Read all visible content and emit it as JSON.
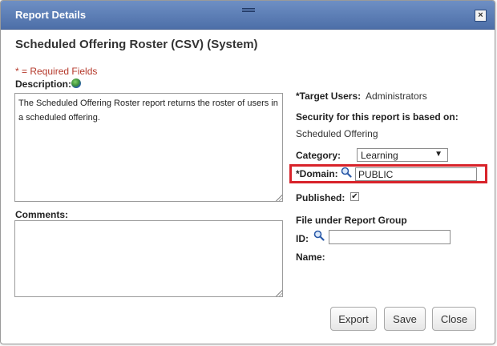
{
  "dialog": {
    "title": "Report Details"
  },
  "report": {
    "heading": "Scheduled Offering Roster (CSV) (System)",
    "required_note": "* = Required Fields",
    "description_label": "Description:",
    "description_text": "The Scheduled Offering Roster report returns the roster of users in a scheduled offering.",
    "comments_label": "Comments:",
    "comments_text": ""
  },
  "details": {
    "target_users_label": "*Target Users:",
    "target_users_value": "Administrators",
    "security_label": "Security for this report is based on:",
    "security_value": "Scheduled Offering",
    "category_label": "Category:",
    "category_value": "Learning",
    "domain_label": "*Domain:",
    "domain_value": "PUBLIC",
    "published_label": "Published:",
    "published_checked": true,
    "report_group_label": "File under Report Group",
    "id_label": "ID:",
    "id_value": "",
    "name_label": "Name:"
  },
  "buttons": {
    "export": "Export",
    "save": "Save",
    "close": "Close"
  },
  "colors": {
    "titlebar": "#5a7cb5",
    "required": "#b5392b",
    "highlight": "#d8232a"
  },
  "icons": {
    "close": "close-icon",
    "globe": "globe-icon",
    "search": "magnifier-icon",
    "grip": "drag-grip-icon"
  }
}
